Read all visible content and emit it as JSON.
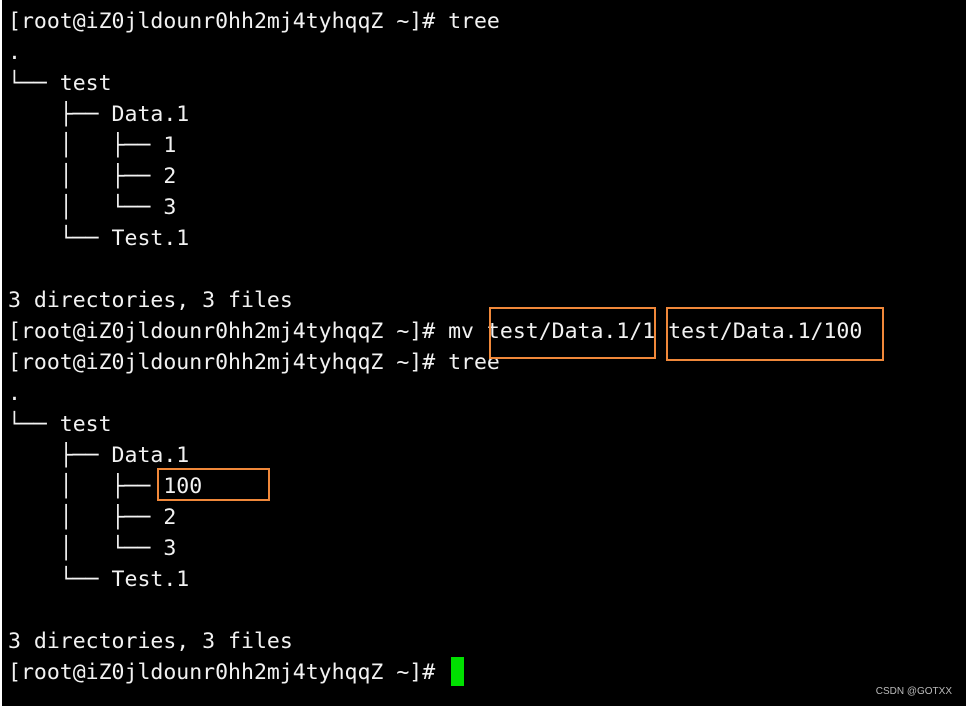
{
  "terminal": {
    "lines": [
      "[root@iZ0jldounr0hh2mj4tyhqqZ ~]# tree",
      ".",
      "└── test",
      "    ├── Data.1",
      "    │   ├── 1",
      "    │   ├── 2",
      "    │   └── 3",
      "    └── Test.1",
      "",
      "3 directories, 3 files",
      "[root@iZ0jldounr0hh2mj4tyhqqZ ~]# mv test/Data.1/1 test/Data.1/100",
      "[root@iZ0jldounr0hh2mj4tyhqqZ ~]# tree",
      ".",
      "└── test",
      "    ├── Data.1",
      "    │   ├── 100",
      "    │   ├── 2",
      "    │   └── 3",
      "    └── Test.1",
      "",
      "3 directories, 3 files",
      "[root@iZ0jldounr0hh2mj4tyhqqZ ~]# "
    ],
    "cursor_color": "#00e000",
    "highlight_color": "#f0883a"
  },
  "watermark": "CSDN @GOTXX"
}
